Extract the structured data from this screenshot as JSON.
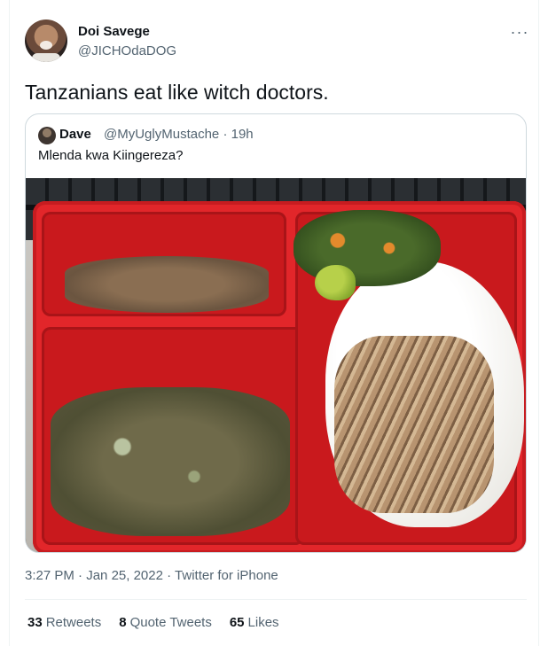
{
  "tweet": {
    "author_name": "Doi Savege",
    "author_handle": "@JICHOdaDOG",
    "more_icon": "more-horizontal-icon",
    "more_glyph": "···",
    "text": "Tanzanians eat like witch doctors.",
    "timestamp": {
      "time": "3:27 PM",
      "separator": " · ",
      "date": "Jan 25, 2022",
      "source": "Twitter for iPhone"
    },
    "stats": [
      {
        "count": "33",
        "label": "Retweets"
      },
      {
        "count": "8",
        "label": "Quote Tweets"
      },
      {
        "count": "65",
        "label": "Likes"
      }
    ]
  },
  "quoted_tweet": {
    "author_name": "Dave",
    "author_handle": "@MyUglyMustache",
    "time_ago": "· 19h",
    "text": "Mlenda kwa Kiingereza?"
  },
  "colors": {
    "text_primary": "#0f1419",
    "text_secondary": "#536471",
    "border": "#cfd9de",
    "tray_red": "#e2262a"
  }
}
